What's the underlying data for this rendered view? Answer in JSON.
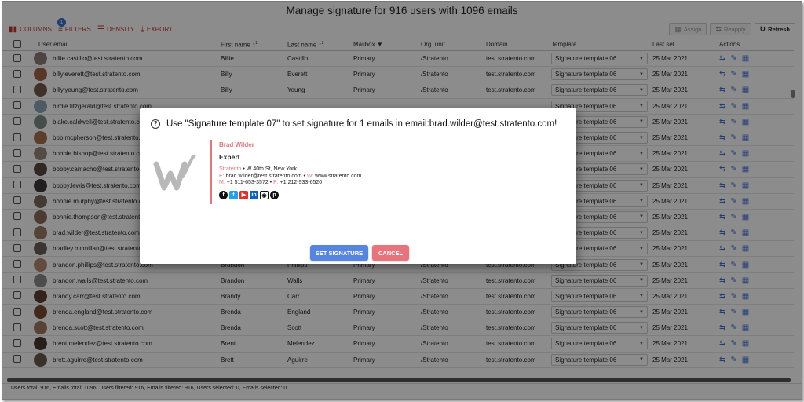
{
  "title": "Manage signature for 916 users with 1096 emails",
  "toolbar": {
    "columns": "COLUMNS",
    "filters": "FILTERS",
    "filters_badge": "1",
    "density": "DENSITY",
    "export": "EXPORT",
    "assign": "Assign",
    "reapply": "Reapply",
    "refresh": "Refresh"
  },
  "columns": {
    "email": "User email",
    "first": "First name",
    "first_sort": "1",
    "last": "Last name",
    "last_sort": "2",
    "mailbox": "Mailbox",
    "org": "Org. unit",
    "domain": "Domain",
    "template": "Template",
    "lastset": "Last set",
    "actions": "Actions"
  },
  "rows": [
    {
      "email": "billie.castillo@test.stratento.com",
      "first": "Billie",
      "last": "Castillo",
      "mailbox": "Primary",
      "org": "/Stratento",
      "domain": "test.stratento.com",
      "template": "Signature template 06",
      "lastset": "25 Mar 2021",
      "avatar_color": "#8a7f78"
    },
    {
      "email": "billy.everett@test.stratento.com",
      "first": "Billy",
      "last": "Everett",
      "mailbox": "Primary",
      "org": "/Stratento",
      "domain": "test.stratento.com",
      "template": "Signature template 06",
      "lastset": "25 Mar 2021",
      "avatar_color": "#a06548"
    },
    {
      "email": "billy.young@test.stratento.com",
      "first": "Billy",
      "last": "Young",
      "mailbox": "Primary",
      "org": "/Stratento",
      "domain": "test.stratento.com",
      "template": "Signature template 06",
      "lastset": "25 Mar 2021",
      "avatar_color": "#6f5a4e"
    },
    {
      "email": "birdie.fitzgerald@test.stratento.com",
      "first": "",
      "last": "",
      "mailbox": "",
      "org": "",
      "domain": "",
      "template": "Signature template 06",
      "lastset": "25 Mar 2021",
      "avatar_color": "#8fa5b8"
    },
    {
      "email": "blake.caldwell@test.stratento.com",
      "first": "",
      "last": "",
      "mailbox": "",
      "org": "",
      "domain": "",
      "template": "Signature template 06",
      "lastset": "25 Mar 2021",
      "avatar_color": "#7d8d88"
    },
    {
      "email": "bob.mcpherson@test.stratento.com",
      "first": "",
      "last": "",
      "mailbox": "",
      "org": "",
      "domain": "",
      "template": "Signature template 06",
      "lastset": "25 Mar 2021",
      "avatar_color": "#a8704e"
    },
    {
      "email": "bobbie.bishop@test.stratento.com",
      "first": "",
      "last": "",
      "mailbox": "",
      "org": "",
      "domain": "",
      "template": "Signature template 06",
      "lastset": "25 Mar 2021",
      "avatar_color": "#9a8a7c"
    },
    {
      "email": "bobby.camacho@test.stratento.com",
      "first": "",
      "last": "",
      "mailbox": "",
      "org": "",
      "domain": "",
      "template": "Signature template 06",
      "lastset": "25 Mar 2021",
      "avatar_color": "#5a4a40"
    },
    {
      "email": "bobby.lewis@test.stratento.com",
      "first": "",
      "last": "",
      "mailbox": "",
      "org": "",
      "domain": "",
      "template": "Signature template 06",
      "lastset": "25 Mar 2021",
      "avatar_color": "#3c3a3a"
    },
    {
      "email": "bonnie.murphy@test.stratento.com",
      "first": "",
      "last": "",
      "mailbox": "",
      "org": "",
      "domain": "",
      "template": "Signature template 06",
      "lastset": "25 Mar 2021",
      "avatar_color": "#7a6a60"
    },
    {
      "email": "bonnie.thompson@test.stratento.com",
      "first": "",
      "last": "",
      "mailbox": "",
      "org": "",
      "domain": "",
      "template": "Signature template 06",
      "lastset": "25 Mar 2021",
      "avatar_color": "#8c6b58"
    },
    {
      "email": "brad.wilder@test.stratento.com",
      "first": "",
      "last": "",
      "mailbox": "",
      "org": "",
      "domain": "",
      "template": "Signature template 06",
      "lastset": "25 Mar 2021",
      "avatar_color": "#9c7a62"
    },
    {
      "email": "bradley.mcmillan@test.stratento.com",
      "first": "",
      "last": "",
      "mailbox": "",
      "org": "",
      "domain": "",
      "template": "Signature template 06",
      "lastset": "25 Mar 2021",
      "avatar_color": "#6e6058"
    },
    {
      "email": "brandon.phillips@test.stratento.com",
      "first": "Brandon",
      "last": "Phillips",
      "mailbox": "Primary",
      "org": "/Stratento",
      "domain": "test.stratento.com",
      "template": "Signature template 06",
      "lastset": "25 Mar 2021",
      "avatar_color": "#b48a70"
    },
    {
      "email": "brandon.walls@test.stratento.com",
      "first": "Brandon",
      "last": "Walls",
      "mailbox": "Primary",
      "org": "/Stratento",
      "domain": "test.stratento.com",
      "template": "Signature template 06",
      "lastset": "25 Mar 2021",
      "avatar_color": "#8a8a8a"
    },
    {
      "email": "brandy.carr@test.stratento.com",
      "first": "Brandy",
      "last": "Carr",
      "mailbox": "Primary",
      "org": "/Stratento",
      "domain": "test.stratento.com",
      "template": "Signature template 06",
      "lastset": "25 Mar 2021",
      "avatar_color": "#5c4032"
    },
    {
      "email": "brenda.england@test.stratento.com",
      "first": "Brenda",
      "last": "England",
      "mailbox": "Primary",
      "org": "/Stratento",
      "domain": "test.stratento.com",
      "template": "Signature template 06",
      "lastset": "25 Mar 2021",
      "avatar_color": "#7c4a34"
    },
    {
      "email": "brenda.scott@test.stratento.com",
      "first": "Brenda",
      "last": "Scott",
      "mailbox": "Primary",
      "org": "/Stratento",
      "domain": "test.stratento.com",
      "template": "Signature template 06",
      "lastset": "25 Mar 2021",
      "avatar_color": "#a07860"
    },
    {
      "email": "brent.melendez@test.stratento.com",
      "first": "Brent",
      "last": "Melendez",
      "mailbox": "Primary",
      "org": "/Stratento",
      "domain": "test.stratento.com",
      "template": "Signature template 06",
      "lastset": "25 Mar 2021",
      "avatar_color": "#4a3a32"
    },
    {
      "email": "brett.aguirre@test.stratento.com",
      "first": "Brett",
      "last": "Aguirre",
      "mailbox": "Primary",
      "org": "/Stratento",
      "domain": "test.stratento.com",
      "template": "Signature template 06",
      "lastset": "25 Mar 2021",
      "avatar_color": "#6a5a50"
    }
  ],
  "dialog": {
    "message": "Use \"Signature template 07\" to set signature for 1 emails in email:brad.wilder@test.stratento.com!",
    "set_label": "SET SIGNATURE",
    "cancel_label": "CANCEL",
    "signature": {
      "name": "Brad Wilder",
      "position": "Expert",
      "company": "Stratento",
      "address": " • W 40th St, New York",
      "email_prefix": "E:",
      "email": " brad.wilder@test.stratento.com • ",
      "web_prefix": "W:",
      "web": " www.stratento.com",
      "mobile_prefix": "M:",
      "mobile": " +1 511-653-3572 • ",
      "phone_prefix": "P:",
      "phone": " +1 212-933-6520",
      "accent_color": "#e8737a"
    }
  },
  "footer": "Users total: 916, Emails total: 1096, Users filtered: 916, Emails filtered: 916, Users selected: 0, Emails selected: 0"
}
